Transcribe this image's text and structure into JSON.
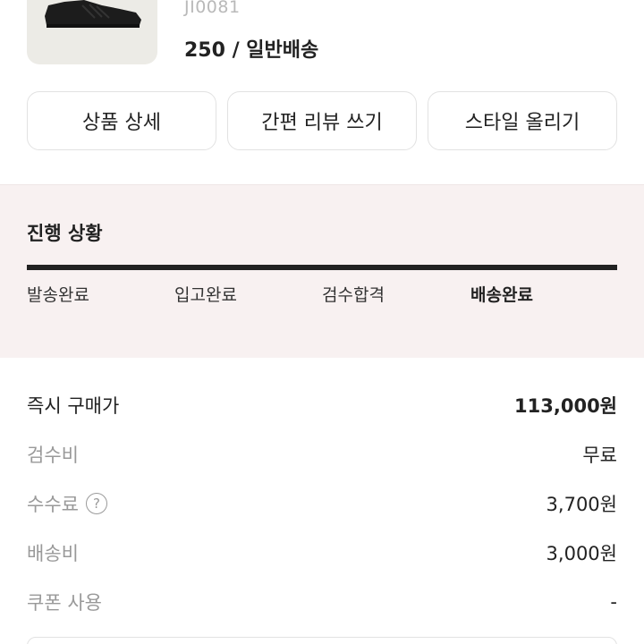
{
  "product": {
    "code": "JI0081",
    "option": "250 / 일반배송",
    "image_icon": "sneaker-icon"
  },
  "actions": [
    {
      "label": "상품 상세"
    },
    {
      "label": "간편 리뷰 쓰기"
    },
    {
      "label": "스타일 올리기"
    }
  ],
  "progress": {
    "title": "진행 상황",
    "completion": 1.0,
    "steps": [
      {
        "label": "발송완료",
        "active": false
      },
      {
        "label": "입고완료",
        "active": false
      },
      {
        "label": "검수합격",
        "active": false
      },
      {
        "label": "배송완료",
        "active": true
      }
    ]
  },
  "fees": [
    {
      "label": "즉시 구매가",
      "value": "113,000원"
    },
    {
      "label": "검수비",
      "value": "무료"
    },
    {
      "label": "수수료",
      "value": "3,700원",
      "help": "?"
    },
    {
      "label": "배송비",
      "value": "3,000원"
    },
    {
      "label": "쿠폰 사용",
      "value": "-"
    }
  ],
  "colors": {
    "progress_bg": "#f8f1f1",
    "bar": "#222222",
    "muted_text": "#999999"
  }
}
